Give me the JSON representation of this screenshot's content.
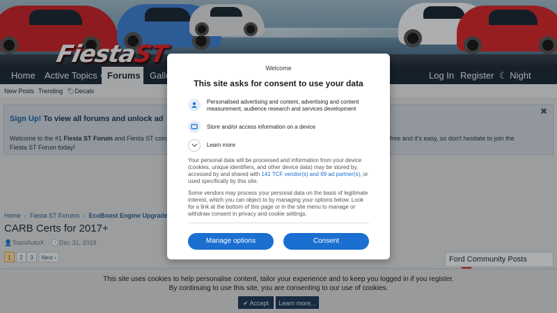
{
  "brand": {
    "logo_text": "Fiesta",
    "logo_accent": "ST",
    "accent_color": "#d9262b",
    "nav_color": "#1e2d3b"
  },
  "nav": {
    "items": [
      {
        "label": "Home"
      },
      {
        "label": "Active Topics"
      },
      {
        "label": "Forums"
      },
      {
        "label": "Galle"
      }
    ],
    "right": {
      "login": "Log In",
      "register": "Register",
      "night_mode": "Night Mode"
    }
  },
  "subnav": {
    "items": [
      "New Posts",
      "Trending",
      "Decals"
    ]
  },
  "notice": {
    "title_link": "Sign Up!",
    "title_rest": "To view all forums and unlock ad",
    "body_start": "Welcome to the #1",
    "body_bold": "Fiesta ST Forum",
    "body_mid": "and Fiesta ST com",
    "body_right": "t, it's free and it's easy, so don't hesitate to join the",
    "body_line2": "Fiesta ST Forum today!"
  },
  "breadcrumb": {
    "items": [
      "Home",
      "Fiesta ST Forums",
      "EcoBoost Engine Upgrades"
    ]
  },
  "thread": {
    "title": "CARB Certs for 2017+",
    "author": "ToastAutoX",
    "date": "Dec 31, 2019"
  },
  "pagination": {
    "pages": [
      "1",
      "2",
      "3"
    ],
    "current": "1",
    "next": "Next"
  },
  "sidebar": {
    "heading": "Ford Community Posts"
  },
  "consent_modal": {
    "welcome": "Welcome",
    "heading": "This site asks for consent to use your data",
    "purposes": [
      {
        "icon": "person-icon",
        "text": "Personalised advertising and content, advertising and content measurement, audience research and services development"
      },
      {
        "icon": "device-icon",
        "text": "Store and/or access information on a device"
      }
    ],
    "learn_more": "Learn more",
    "para1_start": "Your personal data will be processed and information from your device (cookies, unique identifiers, and other device data) may be stored by, accessed by and shared with ",
    "para1_link": "141 TCF vendor(s) and 69 ad partner(s)",
    "para1_end": ", or used specifically by this site.",
    "para2": "Some vendors may process your personal data on the basis of legitimate interest, which you can object to by managing your options below. Look for a link at the bottom of this page or in the site menu to manage or withdraw consent in privacy and cookie settings.",
    "manage_button": "Manage options",
    "consent_button": "Consent",
    "button_color": "#1b6fd0"
  },
  "cookie_bar": {
    "line1": "This site uses cookies to help personalise content, tailor your experience and to keep you logged in if you register.",
    "line2": "By continuing to use this site, you are consenting to our use of cookies.",
    "accept": "Accept",
    "learn_more": "Learn more..."
  }
}
